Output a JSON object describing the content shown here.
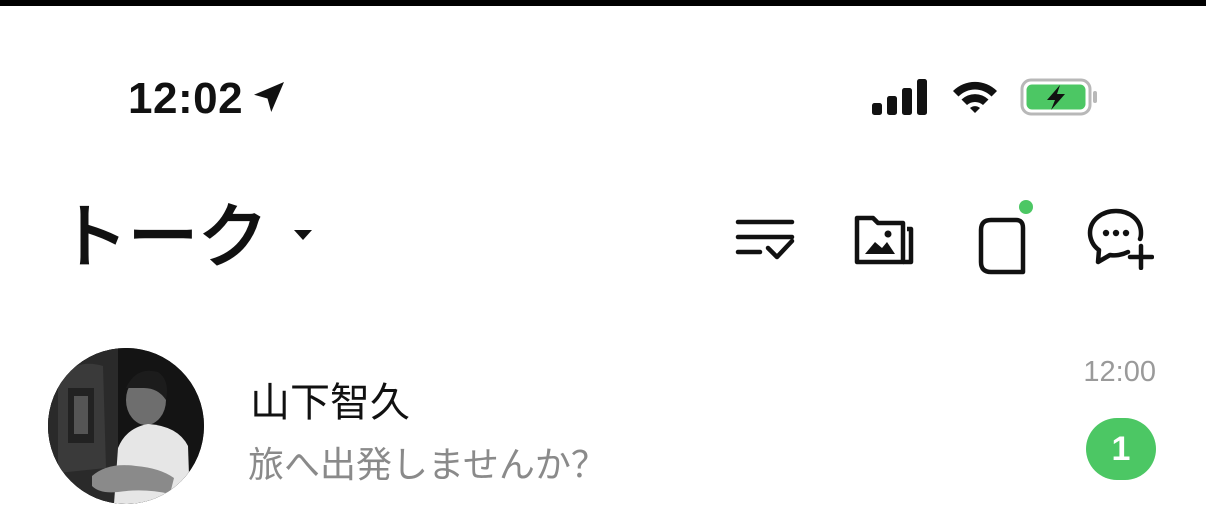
{
  "status_bar": {
    "time": "12:02",
    "location_icon": "location-arrow-icon",
    "signal_icon": "cellular-signal-icon",
    "wifi_icon": "wifi-icon",
    "battery_icon": "battery-charging-icon",
    "battery_color": "#4cc764"
  },
  "header": {
    "title": "トーク",
    "dropdown_icon": "caret-down-icon",
    "icons": [
      "sort-checklist-icon",
      "photo-folder-icon",
      "openchat-icon",
      "new-chat-icon"
    ],
    "notification_dot_color": "#4cc764"
  },
  "chats": [
    {
      "name": "山下智久",
      "preview": "旅へ出発しませんか？",
      "time": "12:00",
      "unread": "1",
      "badge_color": "#4cc764"
    }
  ]
}
